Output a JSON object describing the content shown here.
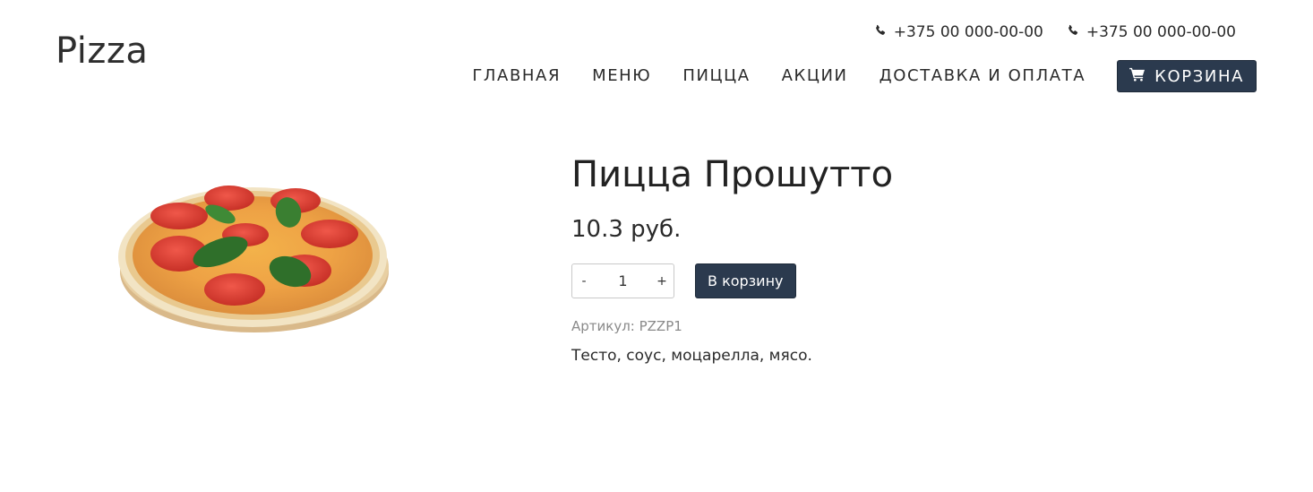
{
  "header": {
    "logo": "Pizza",
    "phones": [
      {
        "number": "+375 00 000-00-00",
        "icon": "phone-icon"
      },
      {
        "number": "+375 00 000-00-00",
        "icon": "phone-icon"
      }
    ],
    "nav": [
      "ГЛАВНАЯ",
      "МЕНЮ",
      "ПИЦЦА",
      "АКЦИИ",
      "ДОСТАВКА И ОПЛАТА"
    ],
    "cart": {
      "label": "КОРЗИНА",
      "icon": "cart-icon"
    }
  },
  "product": {
    "image_icon": "pizza-image",
    "title": "Пицца Прошутто",
    "price": "10.3 руб.",
    "quantity": {
      "minus": "-",
      "value": "1",
      "plus": "+"
    },
    "add_to_cart": "В корзину",
    "sku": "Артикул: PZZP1",
    "description": "Тесто, соус, моцарелла, мясо."
  },
  "colors": {
    "accent": "#2b3a4e",
    "text": "#2a2a2a",
    "muted": "#8a8a8a"
  }
}
